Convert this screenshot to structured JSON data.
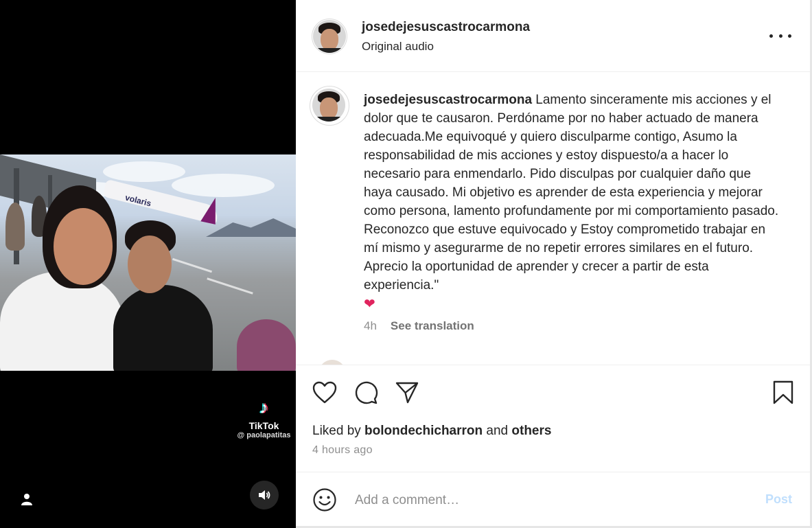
{
  "media": {
    "watermark": {
      "brand": "TikTok",
      "handle": "@ paolapatitas"
    },
    "plane_livery": "volaris",
    "icons": {
      "user": "user-icon",
      "sound": "speaker-icon",
      "tiktok": "tiktok-icon"
    }
  },
  "post": {
    "username": "josedejesuscastrocarmona",
    "audio": "Original audio",
    "caption_user": "josedejesuscastrocarmona",
    "caption_text": "Lamento sinceramente mis acciones y el dolor que te causaron. Perdóname por no haber actuado de manera adecuada.Me equivoqué y quiero disculparme contigo, Asumo la responsabilidad de mis acciones y estoy dispuesto/a a hacer lo necesario para enmendarlo. Pido disculpas por cualquier daño que haya causado. Mi objetivo es aprender de esta experiencia y mejorar como persona, lamento profundamente por mi comportamiento pasado. Reconozco que estuve equivocado y Estoy comprometido trabajar en mí mismo y asegurarme de no repetir errores similares en el futuro. Aprecio la oportunidad de aprender y crecer a partir de esta experiencia.\"",
    "caption_emoji": "❤",
    "age": "4h",
    "see_translation": "See translation"
  },
  "actions": {
    "liked_prefix": "Liked by ",
    "liked_user": "bolondechicharron",
    "liked_and": " and ",
    "liked_others": "others",
    "timestamp": "4 hours ago",
    "icons": [
      "heart-icon",
      "comment-icon",
      "share-icon",
      "bookmark-icon"
    ]
  },
  "comment": {
    "placeholder": "Add a comment…",
    "post_label": "Post",
    "emoji_icon": "emoji-icon"
  },
  "colors": {
    "post_disabled": "#c0dffd",
    "text": "#262626",
    "muted": "#8e8e8e"
  }
}
